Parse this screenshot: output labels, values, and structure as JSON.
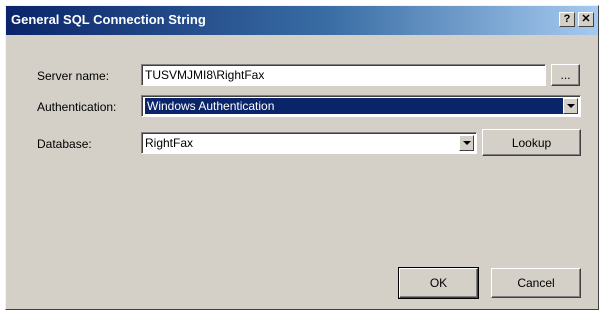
{
  "window": {
    "title": "General SQL Connection String",
    "help_label": "?",
    "close_label": "✕"
  },
  "form": {
    "server_label": "Server name:",
    "server_value": "TUSVMJMI8\\RightFax",
    "browse_label": "...",
    "auth_label": "Authentication:",
    "auth_value": "Windows Authentication",
    "database_label": "Database:",
    "database_value": "RightFax",
    "lookup_label": "Lookup"
  },
  "actions": {
    "ok_label": "OK",
    "cancel_label": "Cancel"
  },
  "colors": {
    "titlebar_start": "#0a246a",
    "titlebar_end": "#a6caf0",
    "dialog_face": "#d4d0c8",
    "selection": "#0a246a"
  },
  "icons": {
    "help": "help-icon",
    "close": "close-icon",
    "dropdown": "chevron-down-icon"
  }
}
